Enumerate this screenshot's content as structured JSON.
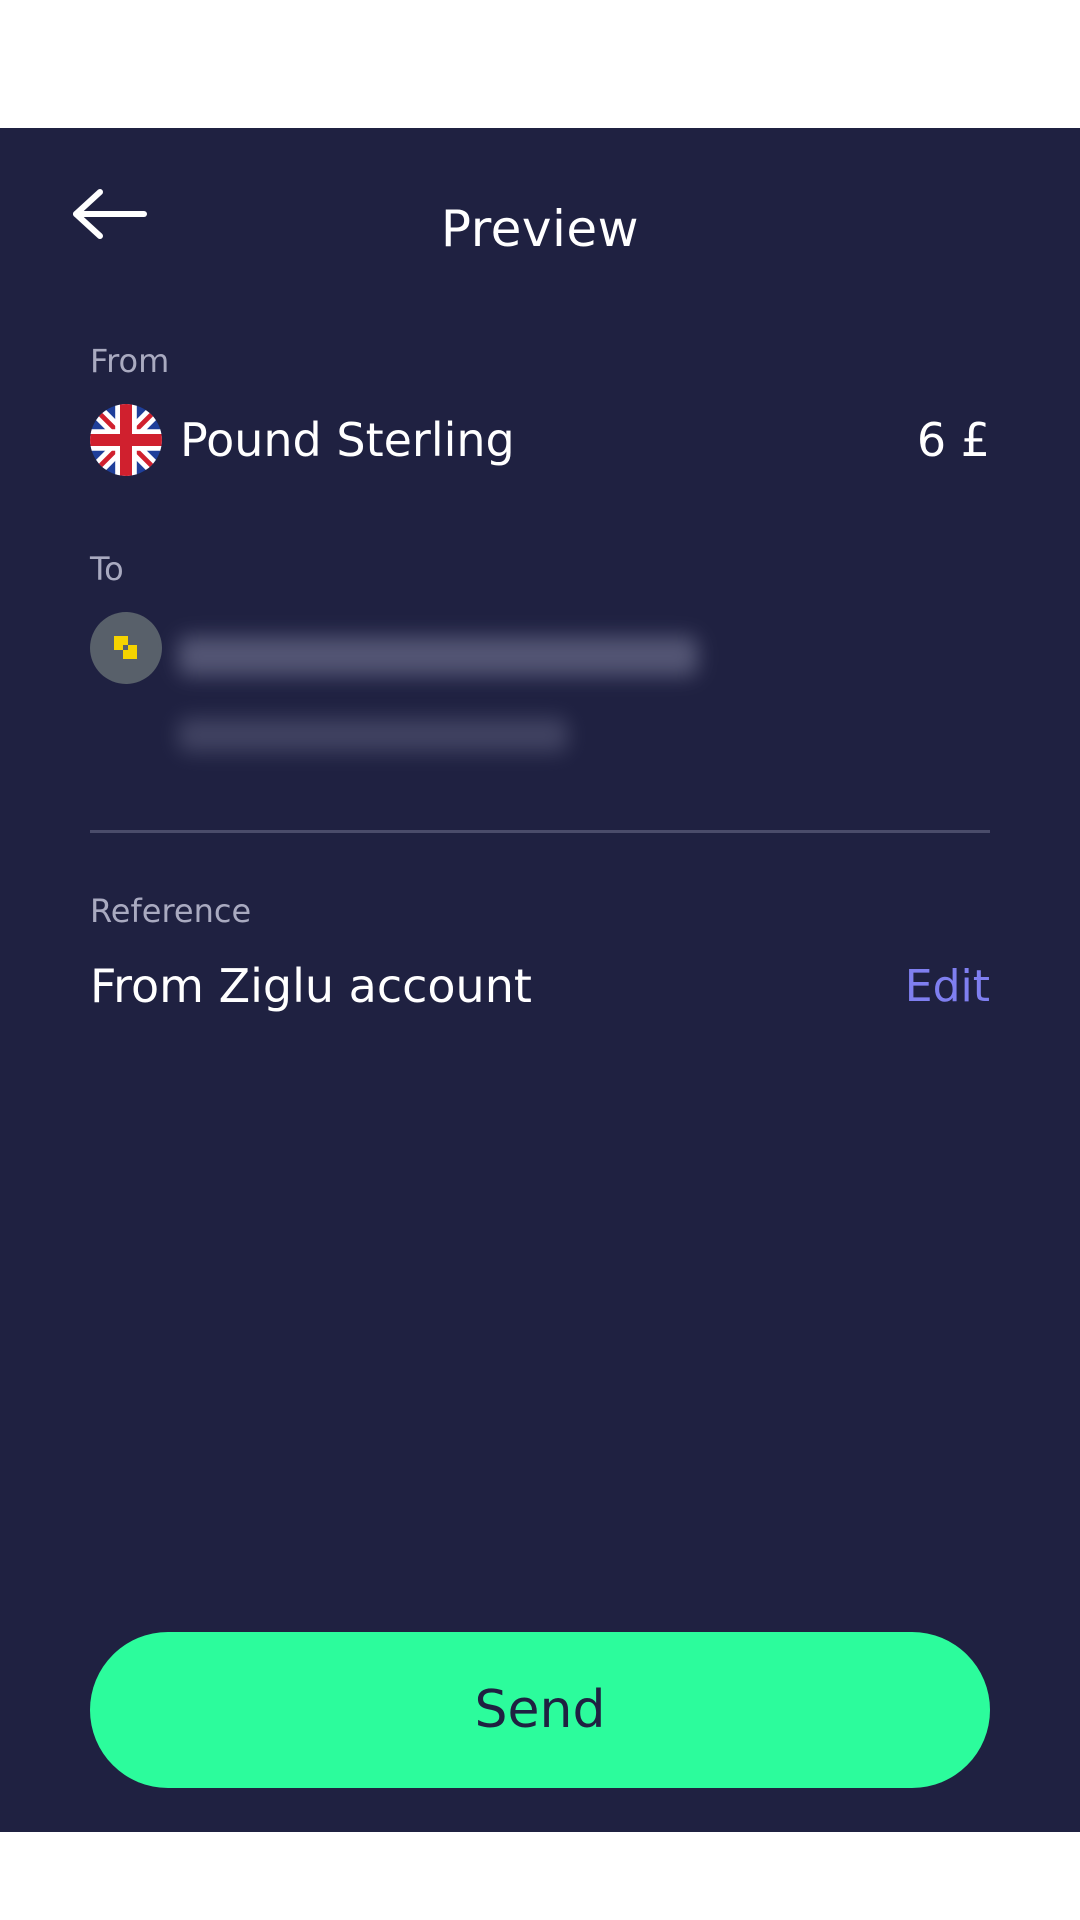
{
  "header": {
    "title": "Preview",
    "back_icon": "arrow-left-icon"
  },
  "from": {
    "label": "From",
    "currency_name": "Pound Sterling",
    "amount": "6 £",
    "flag_icon": "uk-flag-icon"
  },
  "to": {
    "label": "To",
    "avatar_icon": "bank-logo-icon"
  },
  "reference": {
    "label": "Reference",
    "value": "From Ziglu account",
    "edit_label": "Edit"
  },
  "actions": {
    "send_label": "Send"
  },
  "colors": {
    "background": "#1f2141",
    "accent_button": "#2cfc9c",
    "link": "#7f7ff0",
    "muted_text": "#a9aac0"
  }
}
